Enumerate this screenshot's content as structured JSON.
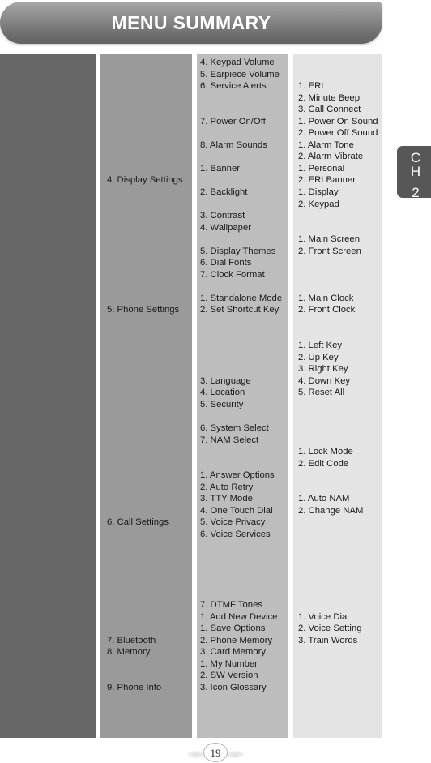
{
  "header": {
    "title": "MENU SUMMARY"
  },
  "chapter_tab": {
    "line1": "C",
    "line2": "H",
    "number": "2"
  },
  "page": {
    "number": "19"
  },
  "columns": {
    "level1": [
      "",
      "",
      "",
      "",
      "",
      "",
      "",
      "",
      "",
      "",
      "4. Display Settings",
      "",
      "",
      "",
      "",
      "",
      "",
      "",
      "",
      "",
      "",
      "5. Phone Settings",
      "",
      "",
      "",
      "",
      "",
      "",
      "",
      "",
      "",
      "",
      "",
      "",
      "",
      "",
      "",
      "",
      "",
      "6. Call Settings",
      "",
      "",
      "",
      "",
      "",
      "",
      "",
      "",
      "",
      "7. Bluetooth",
      "8. Memory",
      "",
      "",
      "9. Phone Info"
    ],
    "level2": [
      "4. Keypad Volume",
      "5. Earpiece Volume",
      "6. Service Alerts",
      "",
      "",
      "7. Power On/Off",
      "",
      "8. Alarm Sounds",
      "",
      "1. Banner",
      "",
      "2. Backlight",
      "",
      "3. Contrast",
      "4. Wallpaper",
      "",
      "5. Display Themes",
      "6. Dial Fonts",
      "7. Clock Format",
      "",
      "1. Standalone Mode",
      "2. Set Shortcut Key",
      "",
      "",
      "",
      "",
      "",
      "3. Language",
      "4. Location",
      "5. Security",
      "",
      "6. System Select",
      "7. NAM Select",
      "",
      "",
      "1. Answer Options",
      "2. Auto Retry",
      "3. TTY Mode",
      "4. One Touch Dial",
      "5. Voice Privacy",
      "6. Voice Services",
      "",
      "",
      "",
      "",
      "",
      "7. DTMF Tones",
      "1. Add New Device",
      "1. Save Options",
      "2. Phone Memory",
      "3. Card Memory",
      "1. My Number",
      "2. SW Version",
      "3. Icon Glossary"
    ],
    "level3": [
      "",
      "",
      "1. ERI",
      "2. Minute Beep",
      "3. Call Connect",
      "1. Power On Sound",
      "2. Power Off Sound",
      "1. Alarm Tone",
      "2. Alarm Vibrate",
      "1. Personal",
      "2. ERI Banner",
      "1. Display",
      "2. Keypad",
      "",
      "",
      "1. Main Screen",
      "2. Front Screen",
      "",
      "",
      "",
      "1. Main Clock",
      "2. Front Clock",
      "",
      "",
      "1. Left Key",
      "2. Up Key",
      "3. Right Key",
      "4. Down Key",
      "5. Reset All",
      "",
      "",
      "",
      "",
      "1. Lock Mode",
      "2. Edit Code",
      "",
      "",
      "1. Auto NAM",
      "2. Change NAM",
      "",
      "",
      "",
      "",
      "",
      "",
      "",
      "",
      "1. Voice Dial",
      "2. Voice Setting",
      "3. Train Words"
    ]
  }
}
